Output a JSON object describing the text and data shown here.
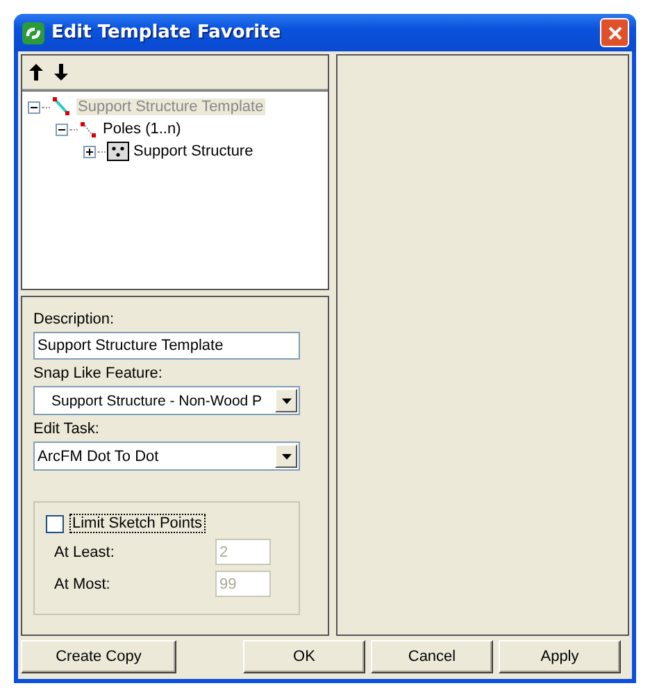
{
  "window": {
    "title": "Edit Template Favorite"
  },
  "tree": [
    {
      "label": "Support Structure Template",
      "selected": true,
      "expanded": true,
      "children": [
        {
          "label": "Poles (1..n)",
          "selected": false,
          "expanded": true,
          "children": [
            {
              "label": "Support Structure",
              "selected": false,
              "expanded": false
            }
          ]
        }
      ]
    }
  ],
  "form": {
    "description_label": "Description:",
    "description": "Support Structure Template",
    "snap_label": "Snap Like Feature:",
    "snap_value": "Support Structure - Non-Wood P",
    "task_label": "Edit Task:",
    "task_value": "ArcFM Dot To Dot",
    "limit": {
      "label": "Limit Sketch Points",
      "checked": false,
      "least_label": "At Least:",
      "least": "2",
      "most_label": "At Most:",
      "most": "99",
      "disabled": true
    }
  },
  "buttons": [
    "Create Copy",
    "OK",
    "Cancel",
    "Apply"
  ]
}
